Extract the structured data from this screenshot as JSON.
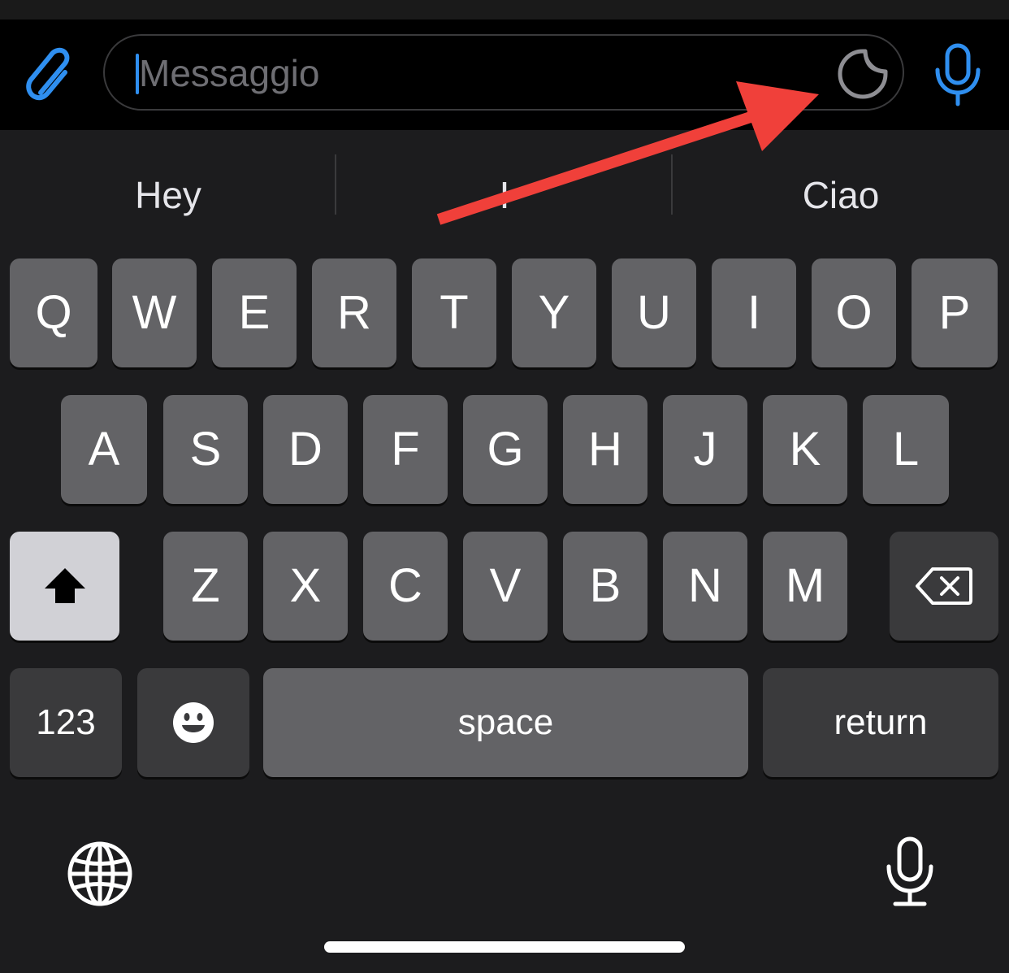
{
  "input": {
    "placeholder": "Messaggio"
  },
  "icons": {
    "attach": "paperclip-icon",
    "sticker": "sticker-icon",
    "mic": "microphone-icon",
    "globe": "globe-icon",
    "emoji": "emoji-icon",
    "shift": "shift-icon",
    "backspace": "backspace-icon"
  },
  "suggestions": [
    "Hey",
    "I",
    "Ciao"
  ],
  "keyboard": {
    "row1": [
      "Q",
      "W",
      "E",
      "R",
      "T",
      "Y",
      "U",
      "I",
      "O",
      "P"
    ],
    "row2": [
      "A",
      "S",
      "D",
      "F",
      "G",
      "H",
      "J",
      "K",
      "L"
    ],
    "row3": [
      "Z",
      "X",
      "C",
      "V",
      "B",
      "N",
      "M"
    ],
    "numbers_label": "123",
    "space_label": "space",
    "return_label": "return"
  },
  "colors": {
    "accent": "#2f8ff0",
    "keyboard_bg": "#1c1c1e",
    "key": "#636366",
    "key_dark": "#3a3a3c",
    "shift_active": "#d1d1d6",
    "annotation_arrow": "#f0403a"
  }
}
